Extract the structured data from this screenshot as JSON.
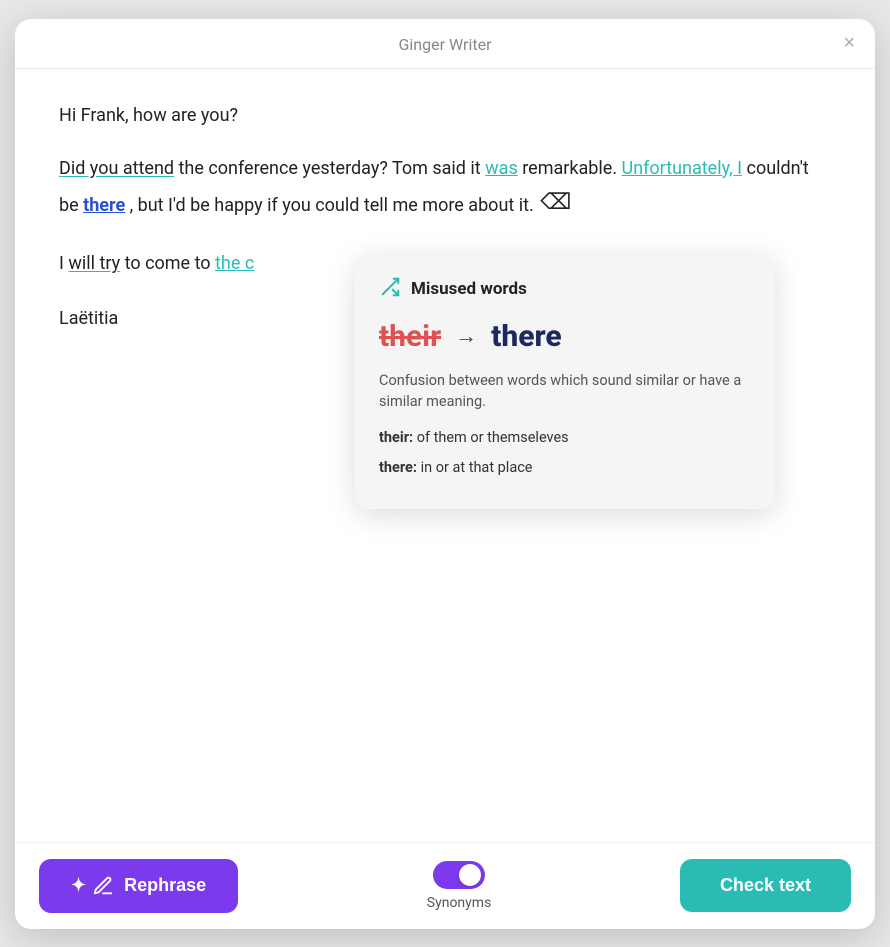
{
  "window": {
    "title": "Ginger Writer"
  },
  "close_button": "×",
  "content": {
    "greeting": "Hi Frank, how are you?",
    "paragraph1_parts": [
      {
        "text": "Did you attend",
        "type": "underline-teal"
      },
      {
        "text": " the conference yesterday? Tom said it ",
        "type": "plain"
      },
      {
        "text": "was",
        "type": "link-teal"
      },
      {
        "text": " remarkable. ",
        "type": "plain"
      },
      {
        "text": "Unfortunately, I",
        "type": "link-teal"
      },
      {
        "text": " couldn't be ",
        "type": "plain"
      },
      {
        "text": "there",
        "type": "word-error"
      },
      {
        "text": ", but I'd be happy if you could tell me more about it.",
        "type": "plain"
      }
    ],
    "paragraph2_parts": [
      {
        "text": "I ",
        "type": "plain"
      },
      {
        "text": "will try",
        "type": "underline-teal"
      },
      {
        "text": " to come to ",
        "type": "plain"
      },
      {
        "text": "the c",
        "type": "link-teal"
      }
    ],
    "signature": "Laëtitia",
    "tooltip": {
      "icon": "⇄",
      "title": "Misused words",
      "wrong_word": "their",
      "arrow": "→",
      "correct_word": "there",
      "description": "Confusion between words which sound similar or have a similar meaning.",
      "def1_word": "their:",
      "def1_text": " of them or themseleves",
      "def2_word": "there:",
      "def2_text": " in or at that place"
    }
  },
  "bottom_bar": {
    "rephrase_label": "Rephrase",
    "rephrase_icon": "✦",
    "synonyms_label": "Synonyms",
    "check_text_label": "Check text"
  }
}
